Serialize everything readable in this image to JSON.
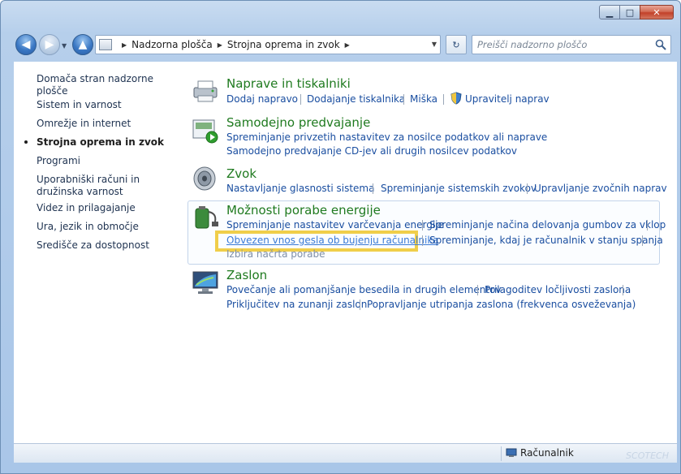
{
  "window": {
    "minimize_label": "▁",
    "maximize_label": "□",
    "close_label": "✕"
  },
  "nav": {
    "breadcrumbs": [
      "Nadzorna plošča",
      "Strojna oprema in zvok"
    ],
    "search_placeholder": "Preišči nadzorno ploščo"
  },
  "sidebar": {
    "items": [
      {
        "label": "Domača stran nadzorne plošče"
      },
      {
        "label": "Sistem in varnost"
      },
      {
        "label": "Omrežje in internet"
      },
      {
        "label": "Strojna oprema in zvok",
        "current": true
      },
      {
        "label": "Programi"
      },
      {
        "label": "Uporabniški računi in družinska varnost"
      },
      {
        "label": "Videz in prilagajanje"
      },
      {
        "label": "Ura, jezik in območje"
      },
      {
        "label": "Središče za dostopnost"
      }
    ]
  },
  "categories": {
    "devices": {
      "title": "Naprave in tiskalniki",
      "links": [
        "Dodaj napravo",
        "Dodajanje tiskalnika",
        "Miška",
        "Upravitelj naprav"
      ]
    },
    "autoplay": {
      "title": "Samodejno predvajanje",
      "links": [
        "Spreminjanje privzetih nastavitev za nosilce podatkov ali naprave",
        "Samodejno predvajanje CD-jev ali drugih nosilcev podatkov"
      ]
    },
    "sound": {
      "title": "Zvok",
      "links": [
        "Nastavljanje glasnosti sistema",
        "Spreminjanje sistemskih zvokov",
        "Upravljanje zvočnih naprav"
      ]
    },
    "power": {
      "title": "Možnosti porabe energije",
      "links": [
        "Spreminjanje nastavitev varčevanja energije",
        "Spreminjanje načina delovanja gumbov za vklop",
        "Obvezen vnos gesla ob bujenju računalnika",
        "Spreminjanje, kdaj je računalnik v stanju spanja",
        "Izbira načrta porabe"
      ]
    },
    "display": {
      "title": "Zaslon",
      "links": [
        "Povečanje ali pomanjšanje besedila in drugih elementov",
        "Prilagoditev ločljivosti zaslona",
        "Priključitev na zunanji zaslon",
        "Popravljanje utripanja zaslona (frekvenca osveževanja)"
      ]
    }
  },
  "status": {
    "computer_label": "Računalnik",
    "watermark": "SCOTECH"
  },
  "colors": {
    "accent_title": "#1f7a1f",
    "link": "#1a4ea0",
    "highlight": "#f0ce4a"
  }
}
